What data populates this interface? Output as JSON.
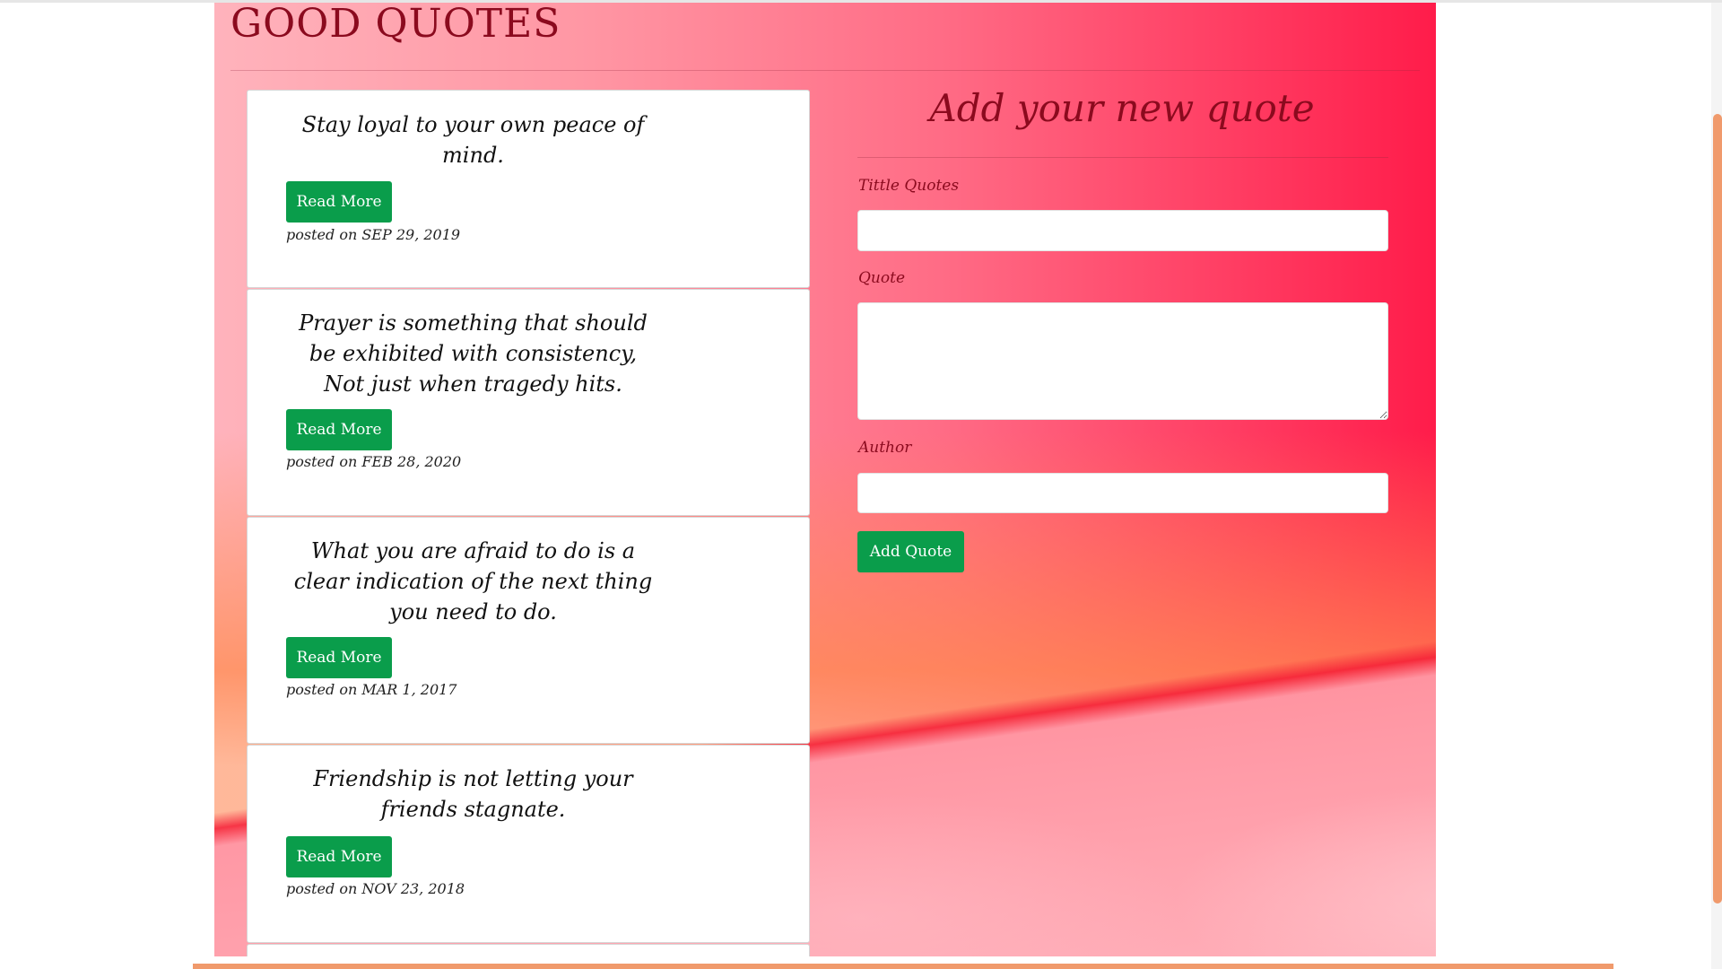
{
  "header": {
    "brand": "GOOD QUOTES"
  },
  "quotes": [
    {
      "text": "Stay loyal to your own peace of mind.",
      "button": "Read More",
      "posted_prefix": "posted on",
      "date": "SEP 29, 2019"
    },
    {
      "text": "Prayer is something that should be exhibited with consistency, Not just when tragedy hits.",
      "button": "Read More",
      "posted_prefix": "posted on",
      "date": "FEB 28, 2020"
    },
    {
      "text": "What you are afraid to do is a clear indication of the next thing you need to do.",
      "button": "Read More",
      "posted_prefix": "posted on",
      "date": "MAR 1, 2017"
    },
    {
      "text": "Friendship is not letting your friends stagnate.",
      "button": "Read More",
      "posted_prefix": "posted on",
      "date": "NOV 23, 2018"
    }
  ],
  "form": {
    "title": "Add your new quote",
    "title_label": "Tittle Quotes",
    "title_value": "",
    "quote_label": "Quote",
    "quote_value": "",
    "author_label": "Author",
    "author_value": "",
    "submit": "Add Quote"
  },
  "colors": {
    "accent_green": "#0a9d4b",
    "heading_red": "#8b0a1e",
    "scrollbar_orange": "#f09a6c"
  }
}
